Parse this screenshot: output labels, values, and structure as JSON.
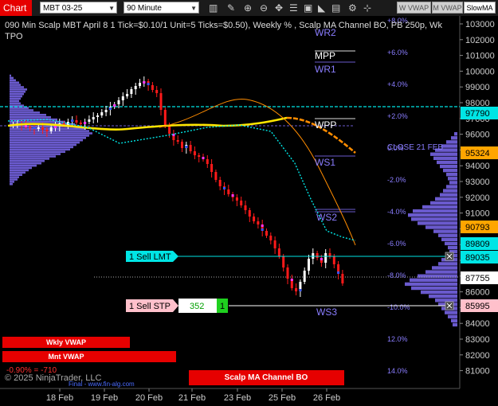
{
  "toolbar": {
    "chart_tab": "Chart",
    "instrument": "MBT 03-25",
    "interval": "90 Minute",
    "icons": [
      "bars-icon",
      "pencil-icon",
      "zoom-in-icon",
      "zoom-out-icon",
      "crosshair-icon",
      "properties-icon",
      "box-icon",
      "drawing-tools-icon",
      "clipboard-icon",
      "strategies-icon",
      "crosshair-alt-icon"
    ],
    "buttons": [
      "W VWAP",
      "M VWAP",
      "SlowMA"
    ]
  },
  "chart": {
    "title": "090 Min Scalp MBT April 8 1 Tick=$0.10/1 Unit=5 Ticks=$0.50), Weekly % , Scalp MA Channel BO, PB 250p, Wk",
    "subtitle": "TPO",
    "copyright": "© 2025 NinjaTrader, LLC",
    "url": "Final - www.fin-alg.com",
    "close_label": "CLOSE 21 FEB",
    "pivots": [
      "WR2",
      "MPP",
      "WR1",
      "WPP",
      "WS1",
      "WS2",
      "WS3"
    ],
    "y_ticks": [
      "103000",
      "102000",
      "101000",
      "100000",
      "99000",
      "98000",
      "97000",
      "96000",
      "95000",
      "94000",
      "93000",
      "92000",
      "91000",
      "90000",
      "89000",
      "88000",
      "87000",
      "86000",
      "85000",
      "84000",
      "83000",
      "82000",
      "81000"
    ],
    "x_ticks": [
      "18 Feb",
      "19 Feb",
      "20 Feb",
      "21 Feb",
      "23 Feb",
      "25 Feb",
      "26 Feb"
    ],
    "pct_labels": [
      "+8.0%",
      "+6.0%",
      "+4.0%",
      "+2.0%",
      "0.0%",
      "-2.0%",
      "-4.0%",
      "-6.0%",
      "-8.0%",
      "-10.0%",
      "12.0%",
      "14.0%"
    ],
    "price_tags": [
      {
        "text": "97790",
        "bg": "#00e5e5",
        "fg": "#000"
      },
      {
        "text": "95324",
        "bg": "#ffa500",
        "fg": "#000"
      },
      {
        "text": "90793",
        "bg": "#ffa500",
        "fg": "#000"
      },
      {
        "text": "89809",
        "bg": "#00e5e5",
        "fg": "#000"
      },
      {
        "text": "89035",
        "bg": "#00e5e5",
        "fg": "#000"
      },
      {
        "text": "87755",
        "bg": "#ffffff",
        "fg": "#000"
      },
      {
        "text": "85995",
        "bg": "#ffc0cb",
        "fg": "#000"
      }
    ],
    "orders": {
      "limit_label": "1 Sell LMT",
      "stop_label": "1 Sell STP",
      "stop_qty": "352",
      "stop_count": "1"
    },
    "status_bars": [
      "Wkly VWAP",
      "Mnt VWAP",
      "Scalp MA Channel BO"
    ],
    "pnl": "-0.90% = -710",
    "colors": {
      "up": "#ffffff",
      "down": "#ff1a1a",
      "cyan": "#00e5e5",
      "yellow": "#ffe600",
      "orange": "#ff8c00",
      "profile": "#6a5acd",
      "red_bar": "#e60000"
    }
  }
}
